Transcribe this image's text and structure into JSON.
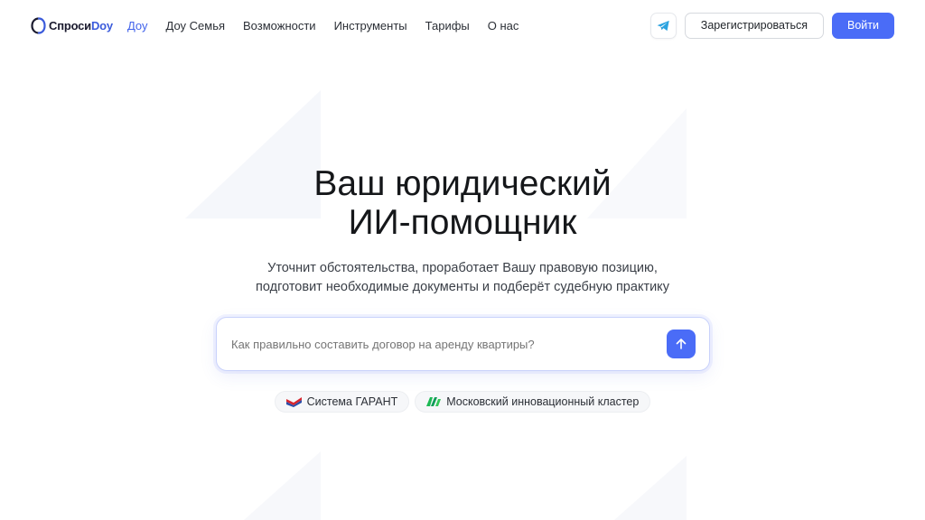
{
  "brand": {
    "part1": "Спроси",
    "part2": "Doy",
    "mark_color": "#3b5bdb"
  },
  "nav": [
    {
      "label": "Доу",
      "active": true
    },
    {
      "label": "Доу Семья",
      "active": false
    },
    {
      "label": "Возможности",
      "active": false
    },
    {
      "label": "Инструменты",
      "active": false
    },
    {
      "label": "Тарифы",
      "active": false
    },
    {
      "label": "О нас",
      "active": false
    }
  ],
  "header": {
    "telegram_icon": "telegram-icon",
    "register_label": "Зарегистрироваться",
    "login_label": "Войти"
  },
  "hero": {
    "title_line1": "Ваш юридический",
    "title_line2": "ИИ-помощник",
    "subtitle_line1": "Уточнит обстоятельства, проработает Вашу правовую позицию,",
    "subtitle_line2": "подготовит необходимые документы и подберёт судебную практику"
  },
  "search": {
    "placeholder": "Как правильно составить договор на аренду квартиры?",
    "send_icon": "arrow-up-icon"
  },
  "badges": [
    {
      "label": "Система ГАРАНТ",
      "icon": "garant-logo-icon"
    },
    {
      "label": "Московский инновационный кластер",
      "icon": "mik-logo-icon"
    }
  ],
  "colors": {
    "accent": "#4a6cf7",
    "active_nav": "#4263eb"
  }
}
